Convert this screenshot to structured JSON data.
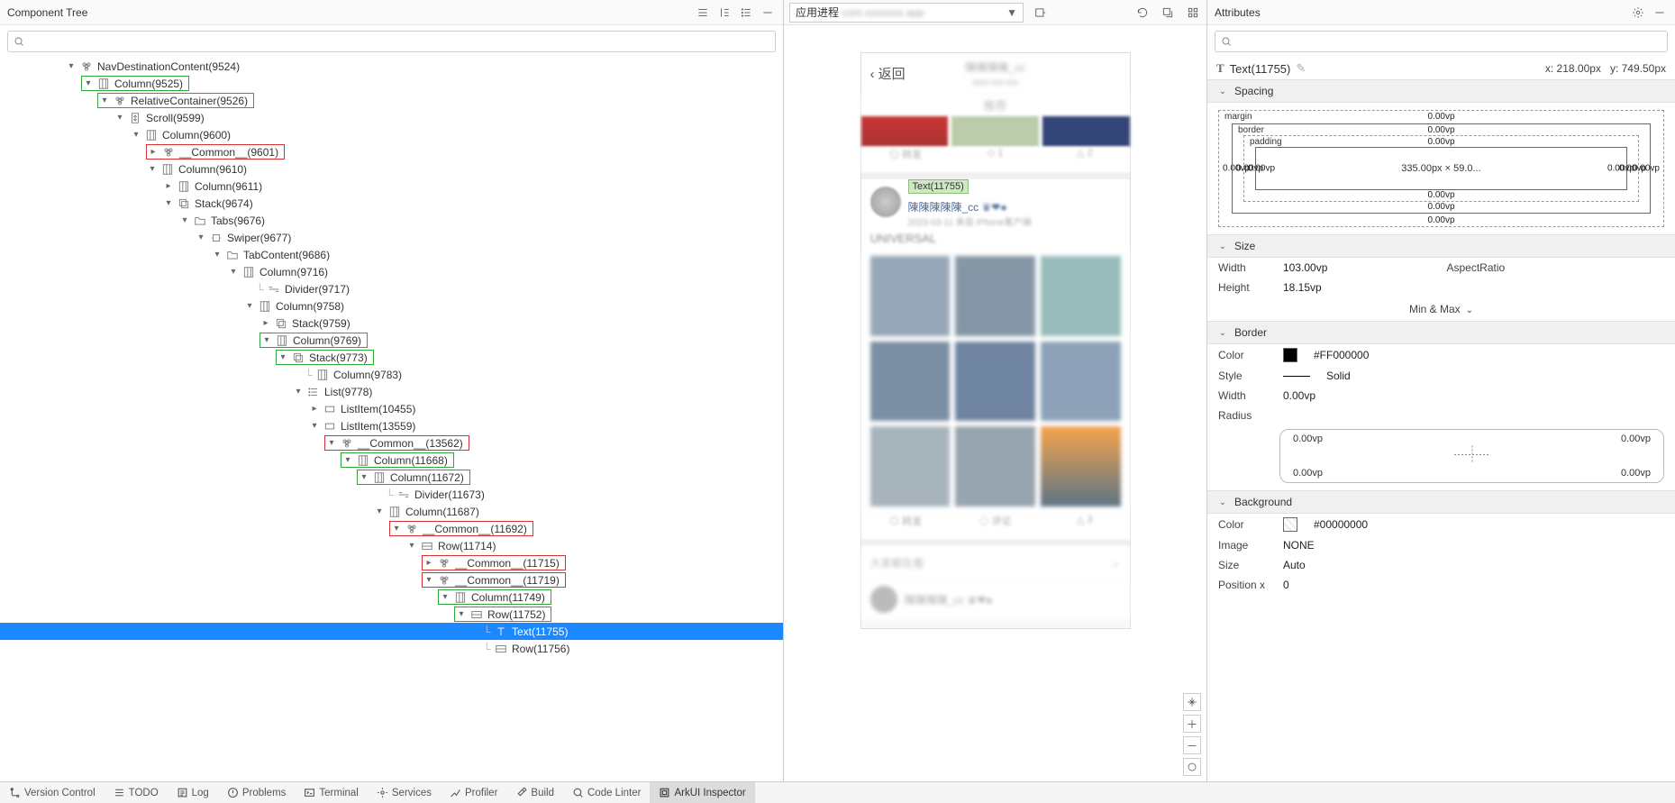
{
  "left_panel": {
    "title": "Component Tree",
    "header_icons": [
      "expand-all-icon",
      "collapse-all-icon",
      "list-view-icon",
      "minimize-icon"
    ]
  },
  "tree": {
    "search_placeholder": "",
    "rows": [
      {
        "indent": 4,
        "caret": "▾",
        "kind": "component",
        "label": "NavDestinationContent(9524)"
      },
      {
        "indent": 5,
        "caret": "▾",
        "kind": "column",
        "label": "Column(9525)",
        "box": "green"
      },
      {
        "indent": 6,
        "caret": "▾",
        "kind": "component",
        "label": "RelativeContainer(9526)",
        "box": "green",
        "half_box": true
      },
      {
        "indent": 7,
        "caret": "▾",
        "kind": "scroll",
        "label": "Scroll(9599)"
      },
      {
        "indent": 8,
        "caret": "▾",
        "kind": "column",
        "label": "Column(9600)"
      },
      {
        "indent": 9,
        "caret": "▸",
        "kind": "component",
        "label": "__Common__(9601)",
        "box": "red"
      },
      {
        "indent": 9,
        "caret": "▾",
        "kind": "column",
        "label": "Column(9610)"
      },
      {
        "indent": 10,
        "caret": "▸",
        "kind": "column",
        "label": "Column(9611)"
      },
      {
        "indent": 10,
        "caret": "▾",
        "kind": "stack",
        "label": "Stack(9674)"
      },
      {
        "indent": 11,
        "caret": "▾",
        "kind": "folder",
        "label": "Tabs(9676)"
      },
      {
        "indent": 12,
        "caret": "▾",
        "kind": "swiper",
        "label": "Swiper(9677)"
      },
      {
        "indent": 13,
        "caret": "▾",
        "kind": "folder",
        "label": "TabContent(9686)"
      },
      {
        "indent": 14,
        "caret": "▾",
        "kind": "column",
        "label": "Column(9716)"
      },
      {
        "indent": 15,
        "caret": "",
        "kind": "divider",
        "label": "Divider(9717)",
        "stub": true
      },
      {
        "indent": 15,
        "caret": "▾",
        "kind": "column",
        "label": "Column(9758)"
      },
      {
        "indent": 16,
        "caret": "▸",
        "kind": "stack",
        "label": "Stack(9759)"
      },
      {
        "indent": 16,
        "caret": "▾",
        "kind": "column",
        "label": "Column(9769)",
        "box": "green"
      },
      {
        "indent": 17,
        "caret": "▾",
        "kind": "stack",
        "label": "Stack(9773)",
        "box": "green",
        "half_box": true
      },
      {
        "indent": 18,
        "caret": "",
        "kind": "column",
        "label": "Column(9783)",
        "stub": true
      },
      {
        "indent": 18,
        "caret": "▾",
        "kind": "list",
        "label": "List(9778)"
      },
      {
        "indent": 19,
        "caret": "▸",
        "kind": "listitem",
        "label": "ListItem(10455)"
      },
      {
        "indent": 19,
        "caret": "▾",
        "kind": "listitem",
        "label": "ListItem(13559)"
      },
      {
        "indent": 20,
        "caret": "▾",
        "kind": "component",
        "label": "__Common__(13562)",
        "box": "red"
      },
      {
        "indent": 21,
        "caret": "▾",
        "kind": "column",
        "label": "Column(11668)",
        "box": "green"
      },
      {
        "indent": 22,
        "caret": "▾",
        "kind": "column",
        "label": "Column(11672)",
        "box": "green",
        "half_box": true
      },
      {
        "indent": 23,
        "caret": "",
        "kind": "divider",
        "label": "Divider(11673)",
        "stub": true
      },
      {
        "indent": 23,
        "caret": "▾",
        "kind": "column",
        "label": "Column(11687)"
      },
      {
        "indent": 24,
        "caret": "▾",
        "kind": "component",
        "label": "__Common__(11692)",
        "box": "red"
      },
      {
        "indent": 25,
        "caret": "▾",
        "kind": "row",
        "label": "Row(11714)"
      },
      {
        "indent": 26,
        "caret": "▸",
        "kind": "component",
        "label": "__Common__(11715)",
        "box": "red"
      },
      {
        "indent": 26,
        "caret": "▾",
        "kind": "component",
        "label": "__Common__(11719)",
        "box": "red",
        "half_box": true
      },
      {
        "indent": 27,
        "caret": "▾",
        "kind": "column",
        "label": "Column(11749)",
        "box": "green"
      },
      {
        "indent": 28,
        "caret": "▾",
        "kind": "row",
        "label": "Row(11752)",
        "box": "green",
        "half_box": true
      },
      {
        "indent": 29,
        "caret": "",
        "kind": "text",
        "label": "Text(11755)",
        "selected": true,
        "stub": true
      },
      {
        "indent": 29,
        "caret": "",
        "kind": "row",
        "label": "Row(11756)",
        "stub": true
      }
    ]
  },
  "center_panel": {
    "process_label": "应用进程",
    "header_icons": [
      "enter-icon",
      "refresh-icon",
      "export-icon",
      "grid-icon"
    ],
    "preview": {
      "back": "‹ 返回",
      "inspect_tag": "Text(11755)",
      "username": "陳陳陳陳陳_cc",
      "title": "UNIVERSAL"
    },
    "zoom_icons": [
      "pan-icon",
      "zoom-in-icon",
      "zoom-out-icon",
      "fit-icon"
    ]
  },
  "right_panel": {
    "title": "Attributes",
    "selected": {
      "label": "Text(11755)",
      "x": "x: 218.00px",
      "y": "y: 749.50px"
    },
    "sections": {
      "spacing_title": "Spacing",
      "size_title": "Size",
      "border_title": "Border",
      "background_title": "Background"
    },
    "spacing": {
      "margin_label": "margin",
      "border_label": "border",
      "padding_label": "padding",
      "margin": {
        "top": "0.00vp",
        "right": "0.00vp",
        "bottom": "0.00vp",
        "left": "0.00vp"
      },
      "border": {
        "top": "0.00vp",
        "right": "0.00vp",
        "bottom": "0.00vp",
        "left": "0.00vp"
      },
      "padding": {
        "top": "0.00vp",
        "right": "0.00vp",
        "bottom": "0.00vp",
        "left": "0.00vp"
      },
      "content": "335.00px × 59.0..."
    },
    "size": {
      "width_label": "Width",
      "width": "103.00vp",
      "height_label": "Height",
      "height": "18.15vp",
      "aspect_label": "AspectRatio",
      "aspect": "",
      "minmax": "Min & Max"
    },
    "border": {
      "color_label": "Color",
      "color": "#FF000000",
      "style_label": "Style",
      "style": "Solid",
      "width_label": "Width",
      "width": "0.00vp",
      "radius_label": "Radius",
      "radius": {
        "tl": "0.00vp",
        "tr": "0.00vp",
        "bl": "0.00vp",
        "br": "0.00vp"
      }
    },
    "background": {
      "color_label": "Color",
      "color": "#00000000",
      "image_label": "Image",
      "image": "NONE",
      "size_label": "Size",
      "size": "Auto",
      "posx_label": "Position x",
      "posx": "0"
    }
  },
  "bottom_bar": {
    "items": [
      {
        "id": "version-control",
        "label": "Version Control"
      },
      {
        "id": "todo",
        "label": "TODO"
      },
      {
        "id": "log",
        "label": "Log"
      },
      {
        "id": "problems",
        "label": "Problems"
      },
      {
        "id": "terminal",
        "label": "Terminal"
      },
      {
        "id": "services",
        "label": "Services"
      },
      {
        "id": "profiler",
        "label": "Profiler"
      },
      {
        "id": "build",
        "label": "Build"
      },
      {
        "id": "code-linter",
        "label": "Code Linter"
      },
      {
        "id": "arkui-inspector",
        "label": "ArkUI Inspector"
      }
    ],
    "active": "arkui-inspector"
  }
}
